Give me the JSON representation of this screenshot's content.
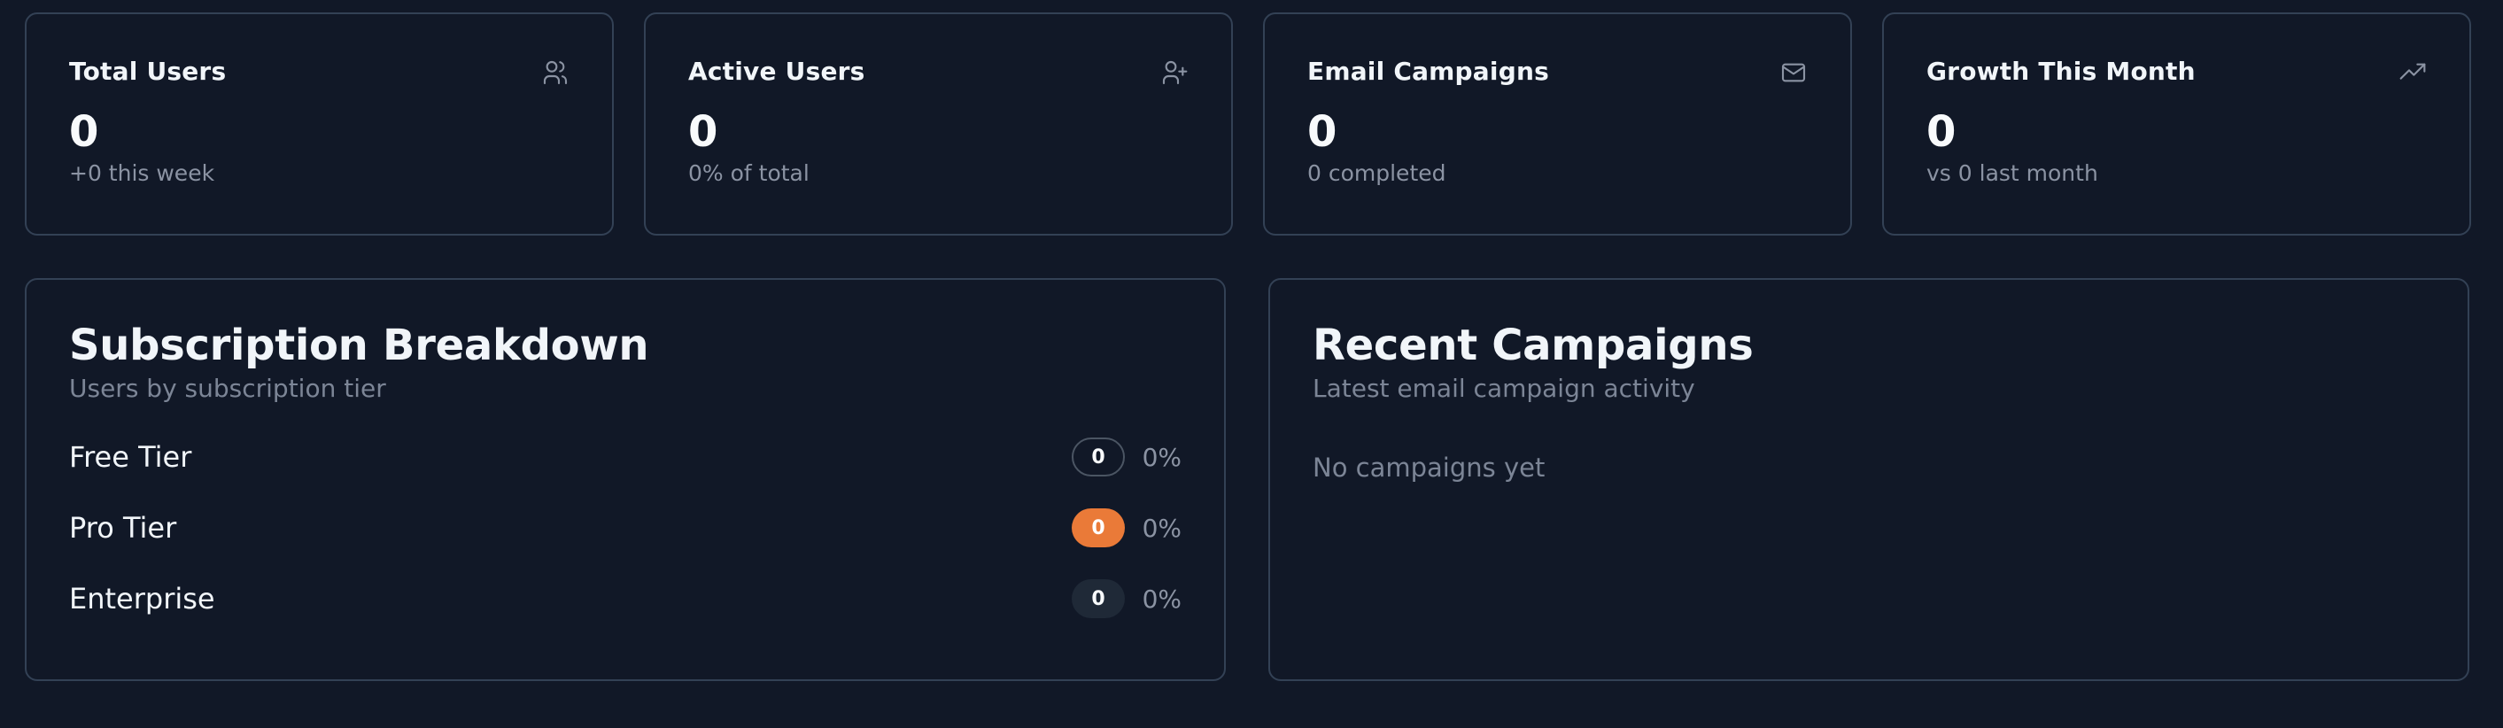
{
  "stats": [
    {
      "title": "Total Users",
      "value": "0",
      "sub": "+0 this week",
      "icon": "users-icon"
    },
    {
      "title": "Active Users",
      "value": "0",
      "sub": "0% of total",
      "icon": "user-plus-icon"
    },
    {
      "title": "Email Campaigns",
      "value": "0",
      "sub": "0 completed",
      "icon": "mail-icon"
    },
    {
      "title": "Growth This Month",
      "value": "0",
      "sub": "vs 0 last month",
      "icon": "trending-up-icon"
    }
  ],
  "subscription": {
    "title": "Subscription Breakdown",
    "subtitle": "Users by subscription tier",
    "tiers": [
      {
        "label": "Free Tier",
        "count": "0",
        "percent": "0%",
        "badge_style": "outline"
      },
      {
        "label": "Pro Tier",
        "count": "0",
        "percent": "0%",
        "badge_style": "orange"
      },
      {
        "label": "Enterprise",
        "count": "0",
        "percent": "0%",
        "badge_style": "dark"
      }
    ]
  },
  "campaigns": {
    "title": "Recent Campaigns",
    "subtitle": "Latest email campaign activity",
    "empty_text": "No campaigns yet"
  },
  "colors": {
    "background": "#111827",
    "border": "#334155",
    "accent_orange": "#ea7a38",
    "muted_text": "#8b93a3"
  }
}
